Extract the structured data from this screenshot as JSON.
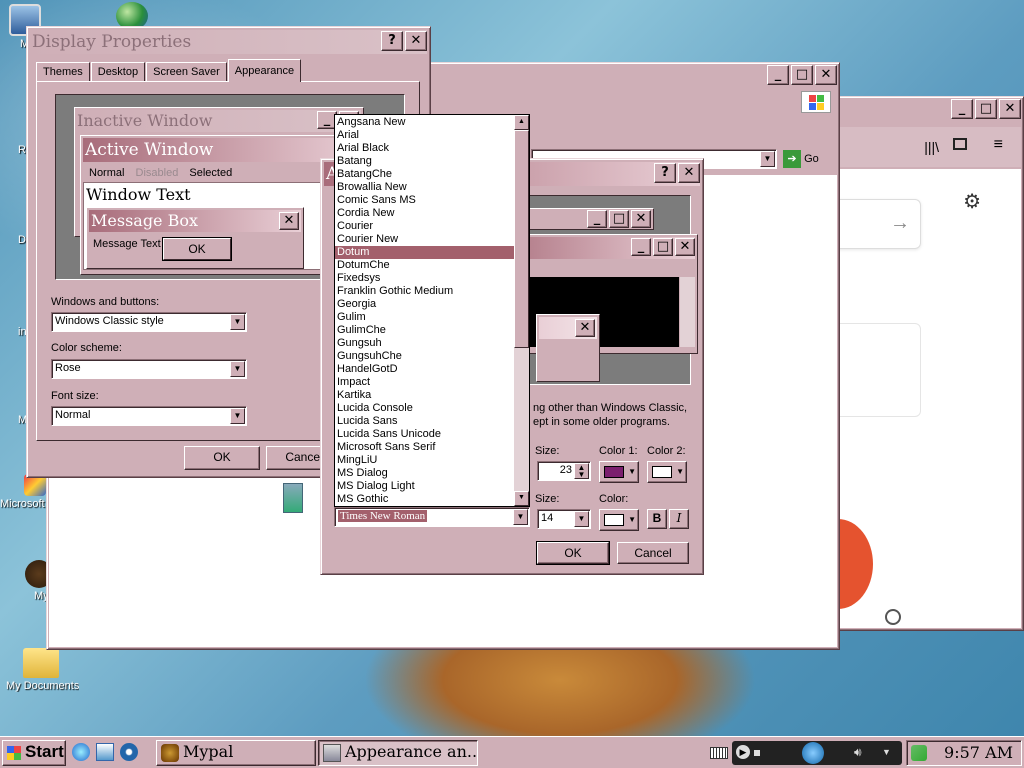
{
  "desktop_icons": [
    {
      "label": "My",
      "icon": "my-computer-icon"
    },
    {
      "label": "Re",
      "icon": "recycle-bin-icon"
    },
    {
      "label": "Data",
      "icon": "data-icon"
    },
    {
      "label": "ins",
      "icon": "installer-icon"
    },
    {
      "label": "Micro E",
      "icon": "app-icon"
    },
    {
      "label": "Microsoft C++",
      "icon": "cpp-icon"
    },
    {
      "label": "My",
      "icon": "shortcut-icon"
    },
    {
      "label": "My Documents",
      "icon": "folder-icon"
    }
  ],
  "display_properties": {
    "title": "Display Properties",
    "tabs": [
      "Themes",
      "Desktop",
      "Screen Saver",
      "Appearance"
    ],
    "selected_tab": "Appearance",
    "preview": {
      "inactive_title": "Inactive Window",
      "active_title": "Active Window",
      "menu_normal": "Normal",
      "menu_disabled": "Disabled",
      "menu_selected": "Selected",
      "window_text": "Window Text",
      "msgbox_title": "Message Box",
      "msgbox_text": "Message Text",
      "msgbox_ok": "OK"
    },
    "windows_buttons_label": "Windows and buttons:",
    "windows_buttons_value": "Windows Classic style",
    "color_scheme_label": "Color scheme:",
    "color_scheme_value": "Rose",
    "font_size_label": "Font size:",
    "font_size_value": "Normal",
    "ok": "OK",
    "cancel": "Cancel"
  },
  "advanced_dialog": {
    "note": "ng other than Windows Classic,\nept in some older programs.",
    "size_label": "Size:",
    "size_value": "23",
    "color1_label": "Color 1:",
    "color2_label": "Color 2:",
    "font_size_label": "Size:",
    "font_size_value": "14",
    "color_label": "Color:",
    "font_value": "Times New Roman",
    "bold": "B",
    "italic": "I",
    "ok": "OK",
    "cancel": "Cancel",
    "preview_a": "A",
    "color1": "#7b1f6e",
    "color2": "#ffffff"
  },
  "font_list": {
    "items": [
      "Angsana New",
      "Arial",
      "Arial Black",
      "Batang",
      "BatangChe",
      "Browallia New",
      "Comic Sans MS",
      "Cordia New",
      "Courier",
      "Courier New",
      "Dotum",
      "DotumChe",
      "Fixedsys",
      "Franklin Gothic Medium",
      "Georgia",
      "Gulim",
      "GulimChe",
      "Gungsuh",
      "GungsuhChe",
      "HandelGotD",
      "Impact",
      "Kartika",
      "Lucida Console",
      "Lucida Sans",
      "Lucida Sans Unicode",
      "Microsoft Sans Serif",
      "MingLiU",
      "MS Dialog",
      "MS Dialog Light",
      "MS Gothic"
    ],
    "selected": "Dotum"
  },
  "browser": {
    "go": "Go"
  },
  "taskbar": {
    "start": "Start",
    "items": [
      {
        "label": "Mypal",
        "icon": "mypal-icon"
      },
      {
        "label": "Appearance an...",
        "icon": "appearance-icon"
      }
    ],
    "clock": "9:57 AM"
  }
}
